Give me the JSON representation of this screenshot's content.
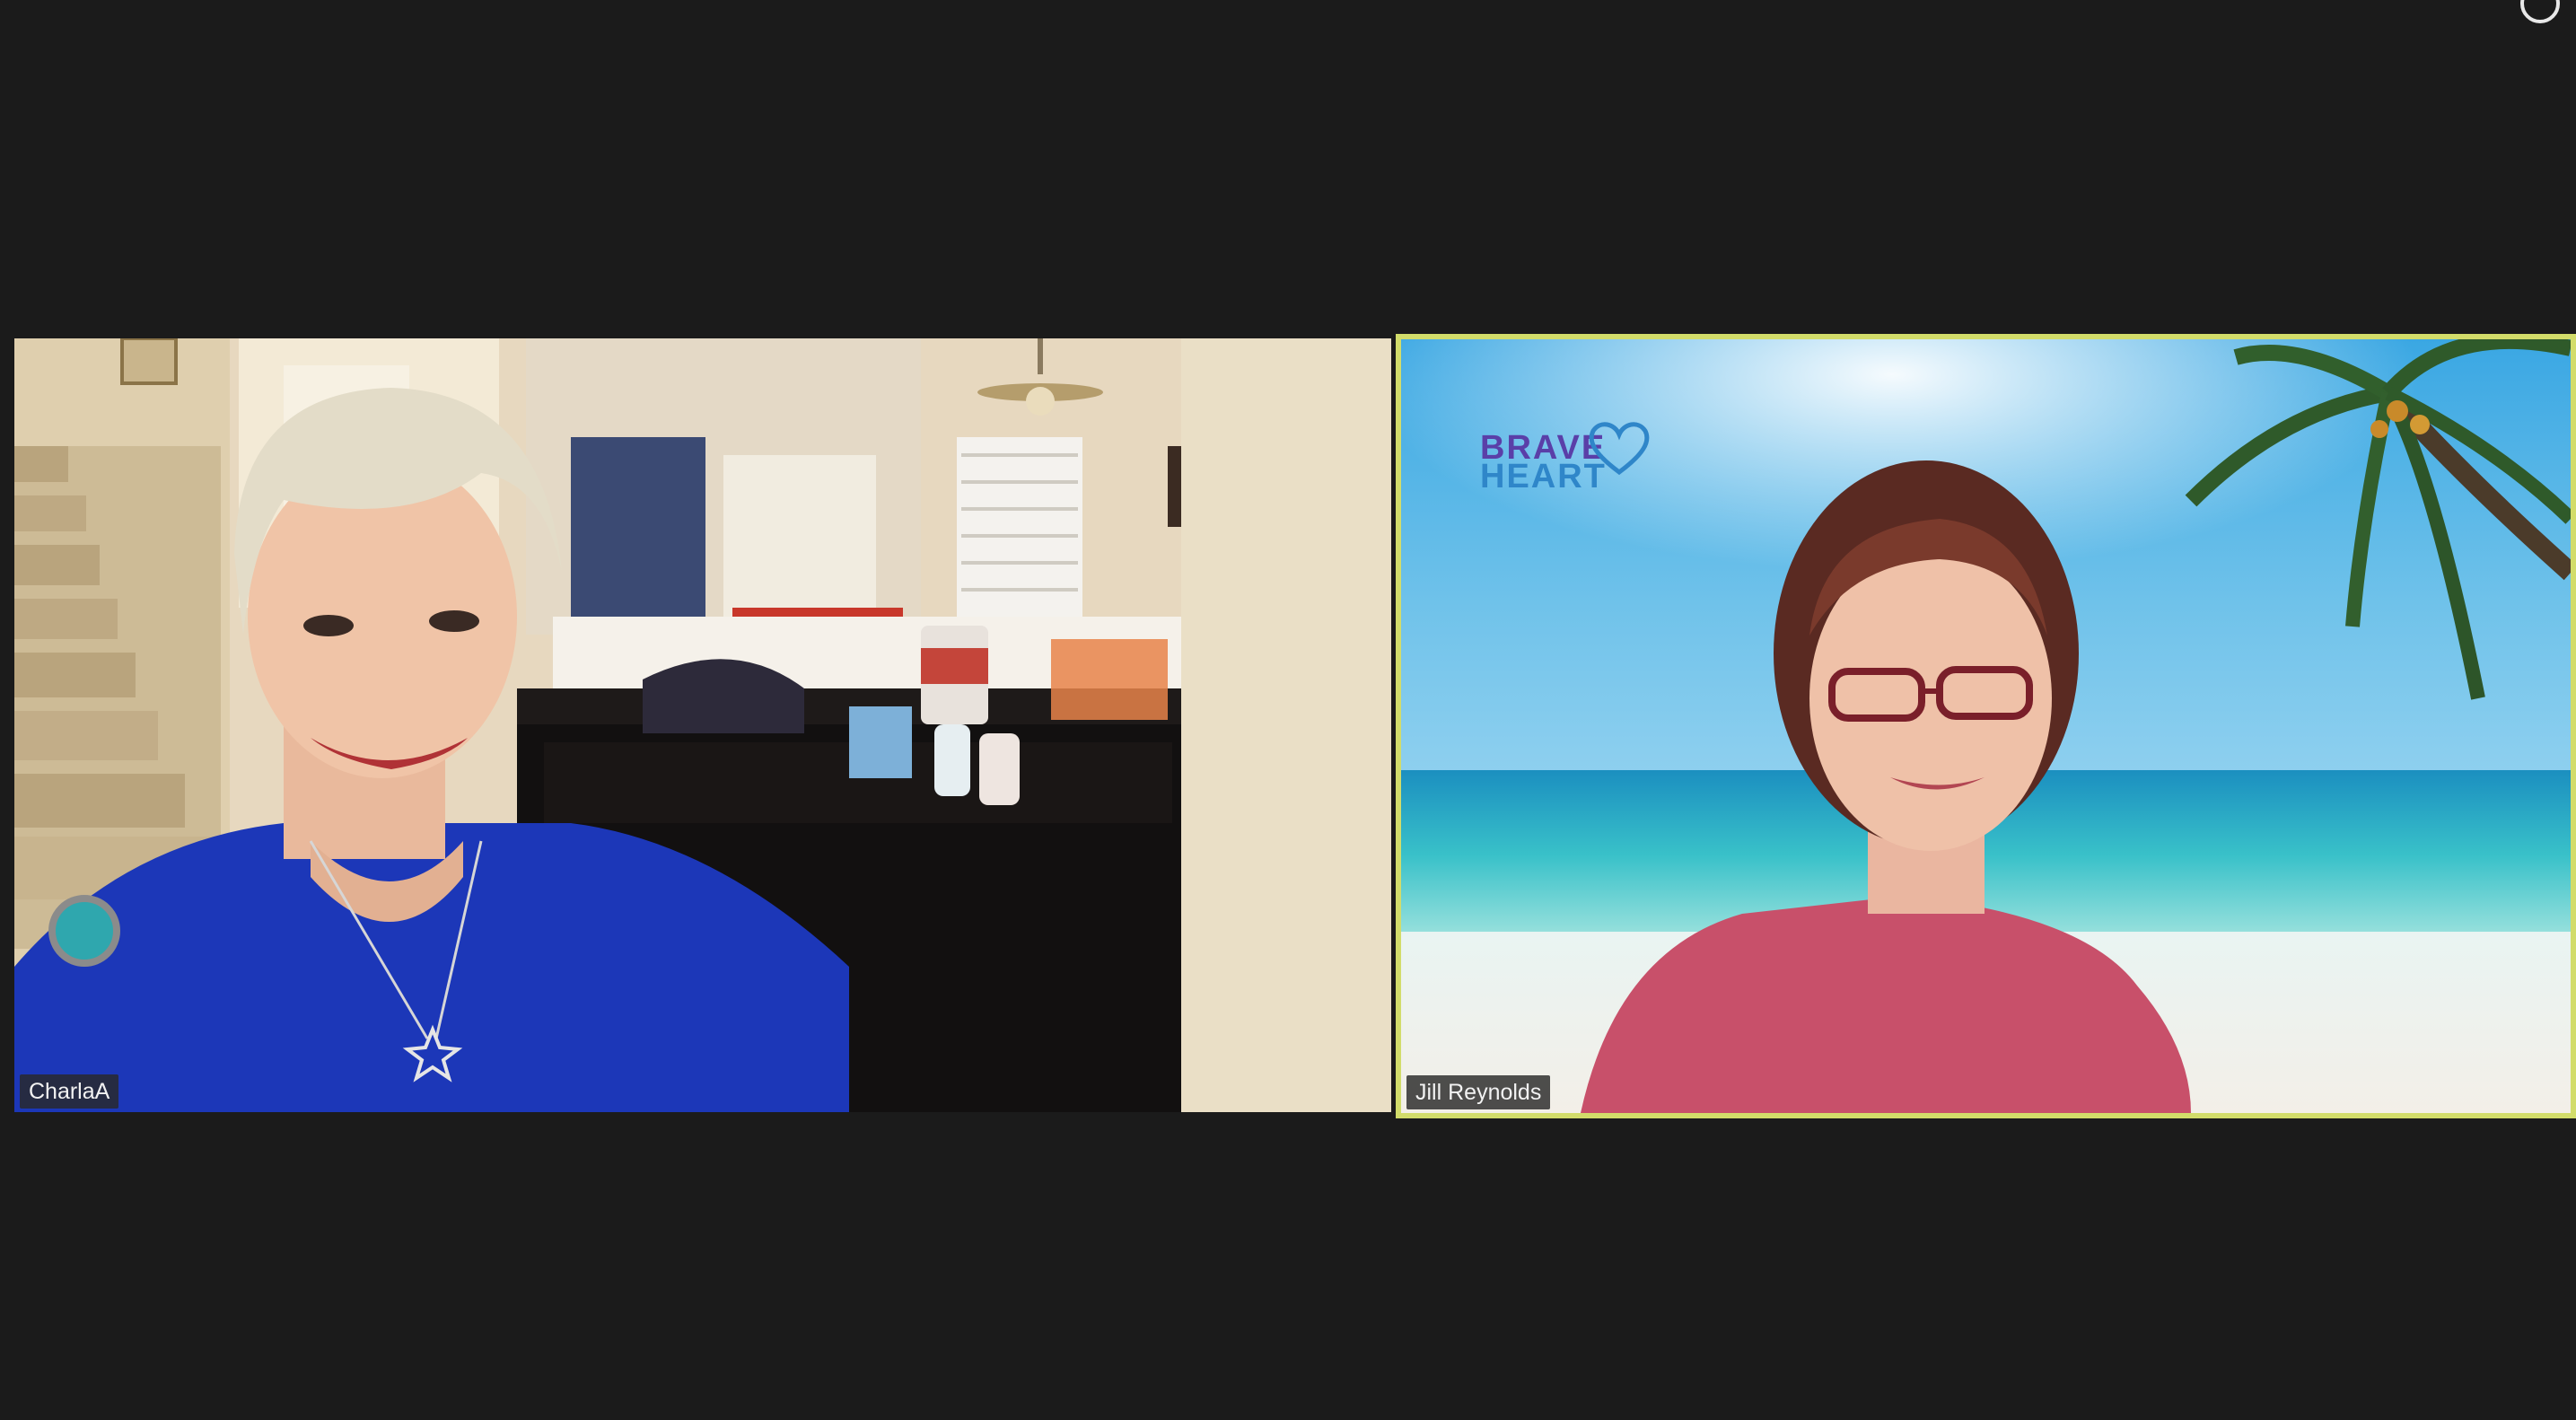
{
  "window": {
    "background": "#1b1b1b",
    "active_speaker_border": "#d2dc6a"
  },
  "participants": [
    {
      "name": "CharlaA"
    },
    {
      "name": "Jill Reynolds",
      "active_speaker": true
    }
  ],
  "virtual_background": {
    "logo_line1": "BRAVE",
    "logo_line2": "HEART",
    "logo_colors": [
      "#5a3fa8",
      "#2f86c9"
    ]
  }
}
